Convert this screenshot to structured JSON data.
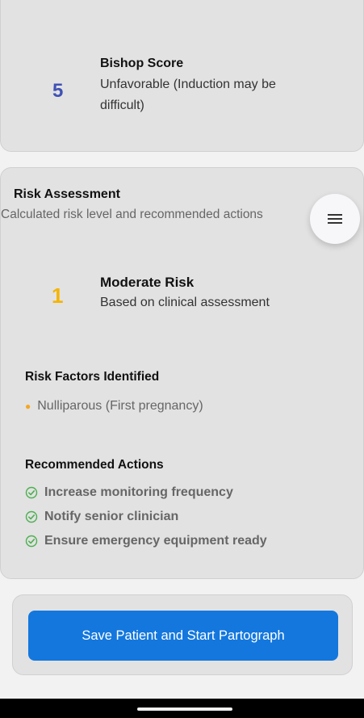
{
  "bishop": {
    "score": "5",
    "title": "Bishop Score",
    "description": "Unfavorable (Induction may be difficult)"
  },
  "risk": {
    "title": "Risk Assessment",
    "subtitle": "Calculated risk level and recommended actions",
    "level_number": "1",
    "level_title": "Moderate Risk",
    "level_description": "Based on clinical assessment",
    "factors_title": "Risk Factors Identified",
    "factors": [
      "Nulliparous (First pregnancy)"
    ],
    "actions_title": "Recommended Actions",
    "actions": [
      "Increase monitoring frequency",
      "Notify senior clinician",
      "Ensure emergency equipment ready"
    ]
  },
  "footer": {
    "save_label": "Save Patient and Start Partograph"
  },
  "icons": {
    "menu": "hamburger-menu-icon",
    "action": "check-badge-icon",
    "factor": "bullet-dot"
  },
  "colors": {
    "bishop_score": "#3f51b5",
    "risk_level": "#f5b400",
    "factor_bullet": "#f5a623",
    "action_icon": "#4caf50",
    "primary_button": "#1377de"
  }
}
